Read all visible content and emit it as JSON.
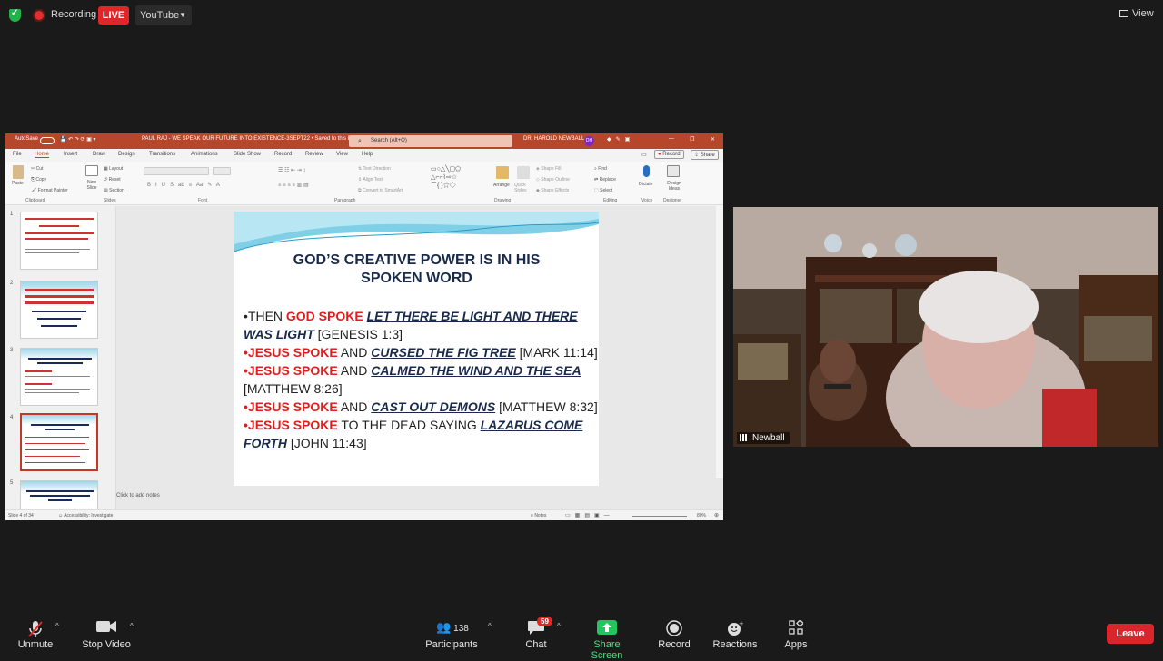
{
  "topbar": {
    "recording_label": "Recording",
    "live_label": "LIVE",
    "stream_target": "YouTube",
    "view_label": "View"
  },
  "ppt": {
    "autosave": "AutoSave",
    "doc_title": "PAUL RAJ - WE SPEAK OUR FUTURE INTO EXISTENCE-3SEPT22 • Saved to this PC",
    "search_placeholder": "Search (Alt+Q)",
    "user": "DR. HAROLD NEWBALL",
    "user_initials": "DH",
    "tabs": [
      "File",
      "Home",
      "Insert",
      "Draw",
      "Design",
      "Transitions",
      "Animations",
      "Slide Show",
      "Record",
      "Review",
      "View",
      "Help"
    ],
    "record_btn": "Record",
    "share_btn": "Share",
    "ribbon_groups": [
      "Clipboard",
      "Slides",
      "Font",
      "Paragraph",
      "Drawing",
      "Editing",
      "Voice",
      "Designer"
    ],
    "ribbon_labels": {
      "paste": "Paste",
      "cut": "Cut",
      "copy": "Copy",
      "format_painter": "Format Painter",
      "new_slide": "New Slide",
      "layout": "Layout",
      "reset": "Reset",
      "section": "Section",
      "text_direction": "Text Direction",
      "align_text": "Align Text",
      "smartart": "Convert to SmartArt",
      "arrange": "Arrange",
      "quick_styles": "Quick Styles",
      "shape_fill": "Shape Fill",
      "shape_outline": "Shape Outline",
      "shape_effects": "Shape Effects",
      "find": "Find",
      "replace": "Replace",
      "select": "Select",
      "dictate": "Dictate",
      "design_ideas": "Design Ideas"
    },
    "thumbnails": [
      {
        "num": "1"
      },
      {
        "num": "2"
      },
      {
        "num": "3"
      },
      {
        "num": "4"
      },
      {
        "num": "5"
      }
    ],
    "slide": {
      "title_line1": "GOD’S CREATIVE POWER IS IN HIS",
      "title_line2": "SPOKEN WORD",
      "b1_a": "•THEN ",
      "b1_red": "GOD SPOKE",
      "b1_em": "LET THERE BE LIGHT AND THERE WAS  LIGHT",
      "b1_ref": " [GENESIS 1:3]",
      "b2_red": "•JESUS SPOKE",
      "b2_and": " AND ",
      "b2_em": "CURSED THE FIG TREE",
      "b2_ref": "  [MARK 11:14]",
      "b3_red": "•JESUS SPOKE",
      "b3_and": " AND ",
      "b3_em": "CALMED THE WIND AND THE SEA",
      "b3_ref": "[MATTHEW 8:26]",
      "b4_red": "•JESUS SPOKE",
      "b4_and": " AND ",
      "b4_em": "CAST OUT DEMONS",
      "b4_ref": " [MATTHEW 8:32]",
      "b5_red": "•JESUS SPOKE",
      "b5_mid": " TO THE DEAD SAYING ",
      "b5_em": "LAZARUS COME FORTH",
      "b5_ref": "  [JOHN 11:43]"
    },
    "notes_placeholder": "Click to add notes",
    "status_slide": "Slide 4 of 34",
    "status_accessibility": "Accessibility: Investigate",
    "status_notes": "Notes",
    "status_zoom": "80%"
  },
  "video": {
    "participant_name": "Newball"
  },
  "toolbar": {
    "unmute": "Unmute",
    "stop_video": "Stop Video",
    "participants_count": "138",
    "participants": "Participants",
    "chat_badge": "59",
    "chat": "Chat",
    "share_screen": "Share Screen",
    "record": "Record",
    "reactions": "Reactions",
    "apps": "Apps",
    "leave": "Leave"
  },
  "colors": {
    "ppt_accent": "#b7472a",
    "live_red": "#e02626",
    "share_green": "#22c55e",
    "slide_red": "#e01e1e",
    "slide_navy": "#1a2a4a"
  }
}
